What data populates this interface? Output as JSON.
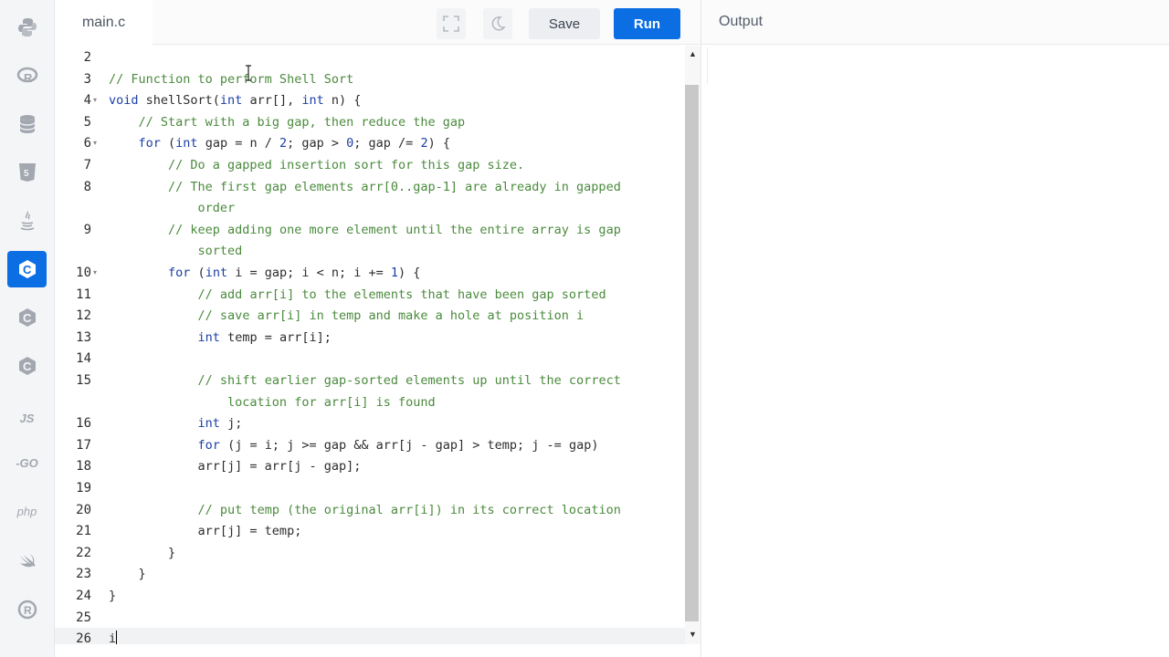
{
  "sidebar": {
    "languages": [
      {
        "name": "python-icon",
        "label": ""
      },
      {
        "name": "r-icon",
        "label": ""
      },
      {
        "name": "database-icon",
        "label": ""
      },
      {
        "name": "html5-icon",
        "label": ""
      },
      {
        "name": "java-icon",
        "label": ""
      },
      {
        "name": "c-icon",
        "label": "",
        "active": true
      },
      {
        "name": "cpp-icon",
        "label": ""
      },
      {
        "name": "csharp-icon",
        "label": ""
      },
      {
        "name": "js-icon",
        "label": "JS"
      },
      {
        "name": "go-icon",
        "label": "-GO"
      },
      {
        "name": "php-icon",
        "label": "php"
      },
      {
        "name": "swift-icon",
        "label": ""
      },
      {
        "name": "rust-icon",
        "label": ""
      }
    ]
  },
  "editor": {
    "file_name": "main.c",
    "save_label": "Save",
    "run_label": "Run",
    "fullscreen_icon": "fullscreen-icon",
    "theme_icon": "moon-icon",
    "current_line": 26,
    "lines": [
      {
        "n": "2",
        "text": ""
      },
      {
        "n": "3",
        "text": "// Function to perform Shell Sort"
      },
      {
        "n": "4",
        "text": "void shellSort(int arr[], int n) {",
        "fold": true
      },
      {
        "n": "5",
        "text": "    // Start with a big gap, then reduce the gap"
      },
      {
        "n": "6",
        "text": "    for (int gap = n / 2; gap > 0; gap /= 2) {",
        "fold": true
      },
      {
        "n": "7",
        "text": "        // Do a gapped insertion sort for this gap size."
      },
      {
        "n": "8",
        "text": "        // The first gap elements arr[0..gap-1] are already in gapped"
      },
      {
        "n": "",
        "text": "            order"
      },
      {
        "n": "9",
        "text": "        // keep adding one more element until the entire array is gap"
      },
      {
        "n": "",
        "text": "            sorted"
      },
      {
        "n": "10",
        "text": "        for (int i = gap; i < n; i += 1) {",
        "fold": true
      },
      {
        "n": "11",
        "text": "            // add arr[i] to the elements that have been gap sorted"
      },
      {
        "n": "12",
        "text": "            // save arr[i] in temp and make a hole at position i"
      },
      {
        "n": "13",
        "text": "            int temp = arr[i];"
      },
      {
        "n": "14",
        "text": ""
      },
      {
        "n": "15",
        "text": "            // shift earlier gap-sorted elements up until the correct"
      },
      {
        "n": "",
        "text": "                location for arr[i] is found"
      },
      {
        "n": "16",
        "text": "            int j;"
      },
      {
        "n": "17",
        "text": "            for (j = i; j >= gap && arr[j - gap] > temp; j -= gap)"
      },
      {
        "n": "18",
        "text": "            arr[j] = arr[j - gap];"
      },
      {
        "n": "19",
        "text": ""
      },
      {
        "n": "20",
        "text": "            // put temp (the original arr[i]) in its correct location"
      },
      {
        "n": "21",
        "text": "            arr[j] = temp;"
      },
      {
        "n": "22",
        "text": "        }"
      },
      {
        "n": "23",
        "text": "    }"
      },
      {
        "n": "24",
        "text": "}"
      },
      {
        "n": "25",
        "text": ""
      },
      {
        "n": "26",
        "text": "i"
      }
    ]
  },
  "output": {
    "title": "Output"
  },
  "colors": {
    "accent": "#0b6ee3",
    "comment": "#4a8a3c",
    "keyword": "#1a3fa6"
  }
}
